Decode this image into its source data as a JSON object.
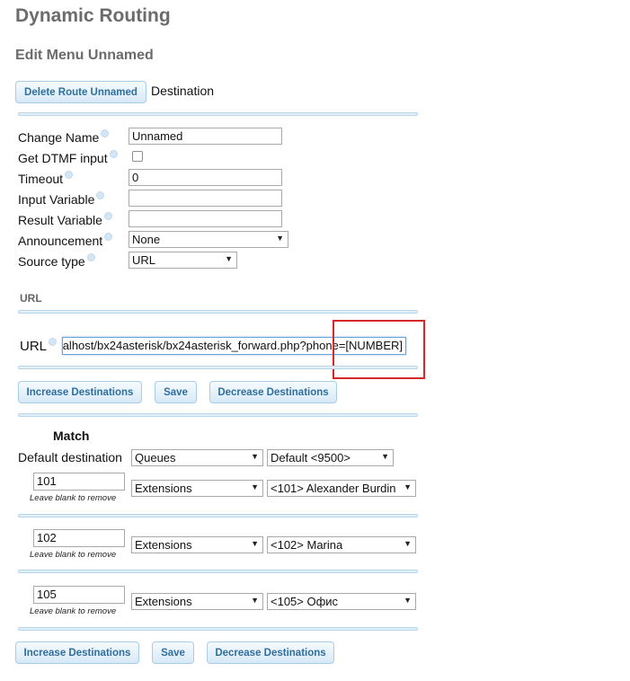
{
  "page": {
    "title": "Dynamic Routing",
    "subtitle": "Edit Menu Unnamed"
  },
  "top": {
    "delete_button": "Delete Route Unnamed",
    "destination_label": "Destination"
  },
  "form": {
    "change_name": {
      "label": "Change Name",
      "value": "Unnamed"
    },
    "get_dtmf": {
      "label": "Get DTMF input",
      "checked": false
    },
    "timeout": {
      "label": "Timeout",
      "value": "0"
    },
    "input_variable": {
      "label": "Input Variable",
      "value": ""
    },
    "result_variable": {
      "label": "Result Variable",
      "value": ""
    },
    "announcement": {
      "label": "Announcement",
      "value": "None"
    },
    "source_type": {
      "label": "Source type",
      "value": "URL"
    }
  },
  "url_section": {
    "heading": "URL",
    "label": "URL",
    "value": "alhost/bx24asterisk/bx24asterisk_forward.php?phone=[NUMBER]"
  },
  "buttons": {
    "increase": "Increase Destinations",
    "save": "Save",
    "decrease": "Decrease Destinations"
  },
  "match": {
    "heading": "Match",
    "default_label": "Default destination",
    "default_type": "Queues",
    "default_target": "Default <9500>",
    "hint": "Leave blank to remove",
    "rows": [
      {
        "value": "101",
        "type": "Extensions",
        "target": "<101> Alexander Burdin"
      },
      {
        "value": "102",
        "type": "Extensions",
        "target": "<102> Marina"
      },
      {
        "value": "105",
        "type": "Extensions",
        "target": "<105> Офис"
      }
    ]
  },
  "icons": {
    "info": "info-icon",
    "dropdown": "dropdown-arrow-icon"
  },
  "colors": {
    "button_text": "#2f6e9e",
    "heading": "#6b6b6b",
    "highlight": "#d9262a"
  }
}
